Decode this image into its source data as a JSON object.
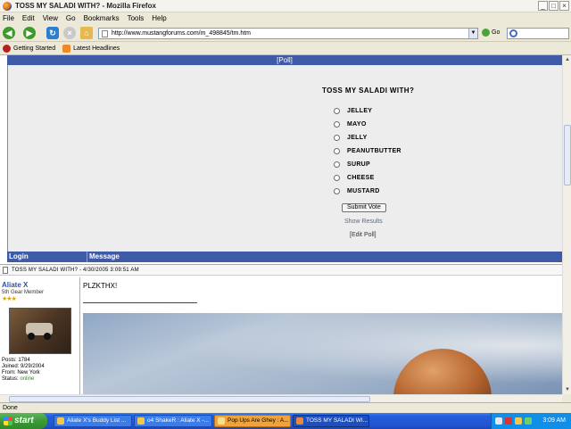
{
  "window": {
    "title": "TOSS MY SALADI WITH? - Mozilla Firefox",
    "controls": [
      "_",
      "□",
      "×"
    ]
  },
  "menu": [
    "File",
    "Edit",
    "View",
    "Go",
    "Bookmarks",
    "Tools",
    "Help"
  ],
  "nav": {
    "url": "http://www.mustangforums.com/m_498845/tm.htm",
    "go_label": "Go"
  },
  "bookmarks": [
    "Getting Started",
    "Latest Headlines"
  ],
  "poll": {
    "header": "[Poll]",
    "question": "TOSS MY SALADI WITH?",
    "options": [
      "JELLEY",
      "MAYO",
      "JELLY",
      "PEANUTBUTTER",
      "SURUP",
      "CHEESE",
      "MUSTARD"
    ],
    "submit_label": "Submit Vote",
    "show_results": "Show Results",
    "edit_poll": "[Edit Poll]"
  },
  "columns": {
    "login": "Login",
    "message": "Message"
  },
  "post": {
    "header": "TOSS MY SALADI WITH? - 4/30/2005 3:09:51 AM",
    "username": "Aliate X",
    "rank": "5th Gear Member",
    "stars": "★★★",
    "posts": "Posts: 1784",
    "joined": "Joined: 9/29/2004",
    "from": "From: New York",
    "status_label": "Status:",
    "status_value": "online",
    "message": "PLZKTHX!"
  },
  "statusbar": "Done",
  "taskbar": {
    "start": "start",
    "tasks": [
      "Aliate X's Buddy List ...",
      "o4 ShakeR : Aliate X -...",
      "Pop Ups Are Ghey : A...",
      "TOSS MY SALADI WI..."
    ],
    "clock": "3:09 AM"
  }
}
